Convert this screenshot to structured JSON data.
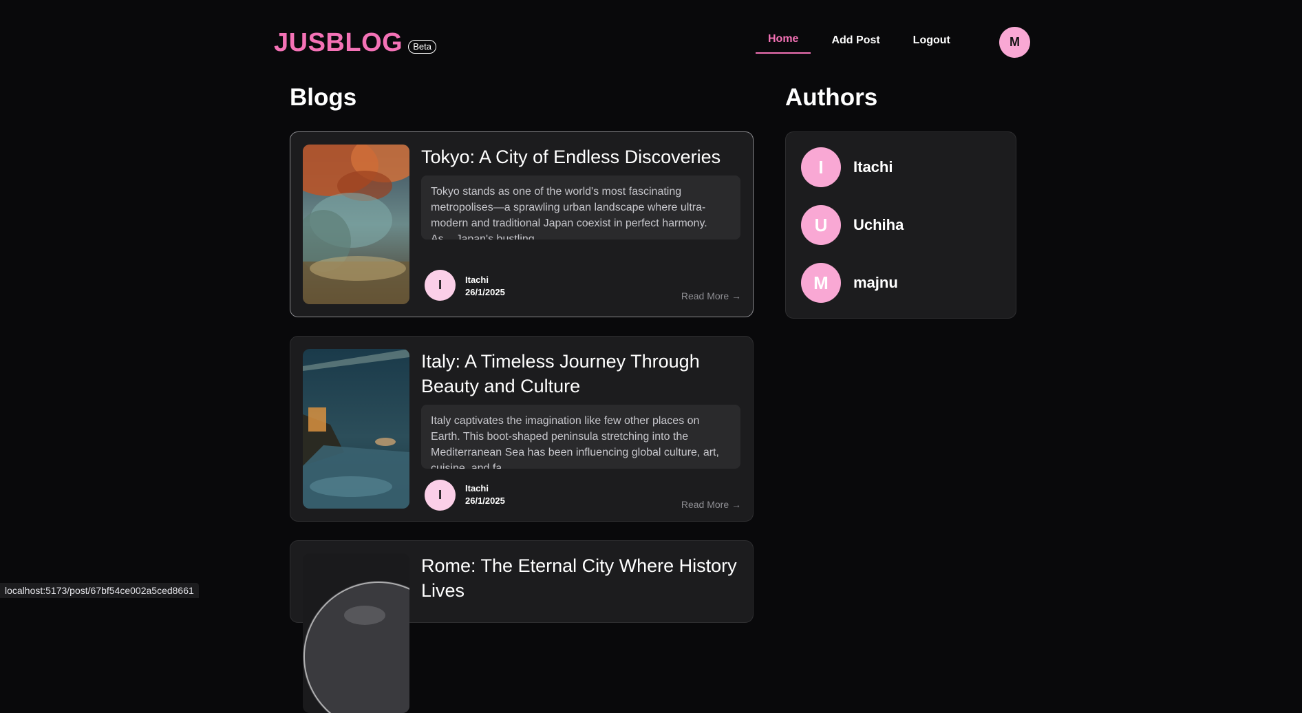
{
  "header": {
    "logo": "JUSBLOG",
    "badge": "Beta",
    "nav": [
      {
        "label": "Home",
        "active": true
      },
      {
        "label": "Add Post",
        "active": false
      },
      {
        "label": "Logout",
        "active": false
      }
    ],
    "user_initial": "M"
  },
  "blogs": {
    "title": "Blogs",
    "posts": [
      {
        "title": "Tokyo: A City of Endless Discoveries",
        "excerpt": "Tokyo stands as one of the world's most fascinating metropolises—a sprawling urban landscape where ultra-modern and traditional Japan coexist in perfect harmony. As... Japan's bustling",
        "author_initial": "I",
        "author": "Itachi",
        "date": "26/1/2025",
        "read_more": "Read More →"
      },
      {
        "title": "Italy: A Timeless Journey Through Beauty and Culture",
        "excerpt": "Italy captivates the imagination like few other places on Earth. This boot-shaped peninsula stretching into the Mediterranean Sea has been influencing global culture, art, cuisine, and fa...",
        "author_initial": "I",
        "author": "Itachi",
        "date": "26/1/2025",
        "read_more": "Read More →"
      },
      {
        "title": "Rome: The Eternal City Where History Lives"
      }
    ]
  },
  "authors": {
    "title": "Authors",
    "list": [
      {
        "initial": "I",
        "name": "Itachi"
      },
      {
        "initial": "U",
        "name": "Uchiha"
      },
      {
        "initial": "M",
        "name": "majnu"
      }
    ]
  },
  "status_bar": {
    "url": "localhost:5173/post/67bf54ce002a5ced8661"
  },
  "colors": {
    "accent": "#f472b6",
    "avatar": "#f9a8d4",
    "background": "#09090b",
    "card": "#1c1c1e"
  }
}
